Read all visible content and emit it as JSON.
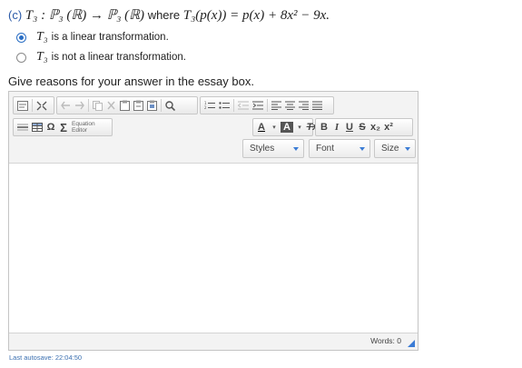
{
  "question": {
    "part_label": "(c)",
    "map_decl": "T₃ : ℙ₃ (ℝ) → ℙ₃ (ℝ)",
    "where_word": "where",
    "definition": "T₃(p(x)) = p(x) + 8x² − 9x."
  },
  "options": [
    {
      "math": "T₃",
      "text": "is a linear transformation.",
      "selected": true
    },
    {
      "math": "T₃",
      "text": "is not a linear transformation.",
      "selected": false
    }
  ],
  "prompt": "Give reasons for your answer in the essay box.",
  "toolbar": {
    "eq_editor_line1": "Equation",
    "eq_editor_line2": "Editor",
    "omega": "Ω",
    "sigma": "Σ",
    "font_color": "A",
    "bg_color": "A",
    "clear_format": "Tx",
    "bold": "B",
    "italic": "I",
    "underline": "U",
    "strike": "S",
    "subscript": "x₂",
    "superscript": "x²",
    "styles_label": "Styles",
    "font_label": "Font",
    "size_label": "Size"
  },
  "editor": {
    "content": "",
    "word_count_label": "Words: 0"
  },
  "autosave": "Last autosave: 22:04:50",
  "colors": {
    "accent": "#3a7bd5",
    "part_label": "#2a5aa8"
  }
}
